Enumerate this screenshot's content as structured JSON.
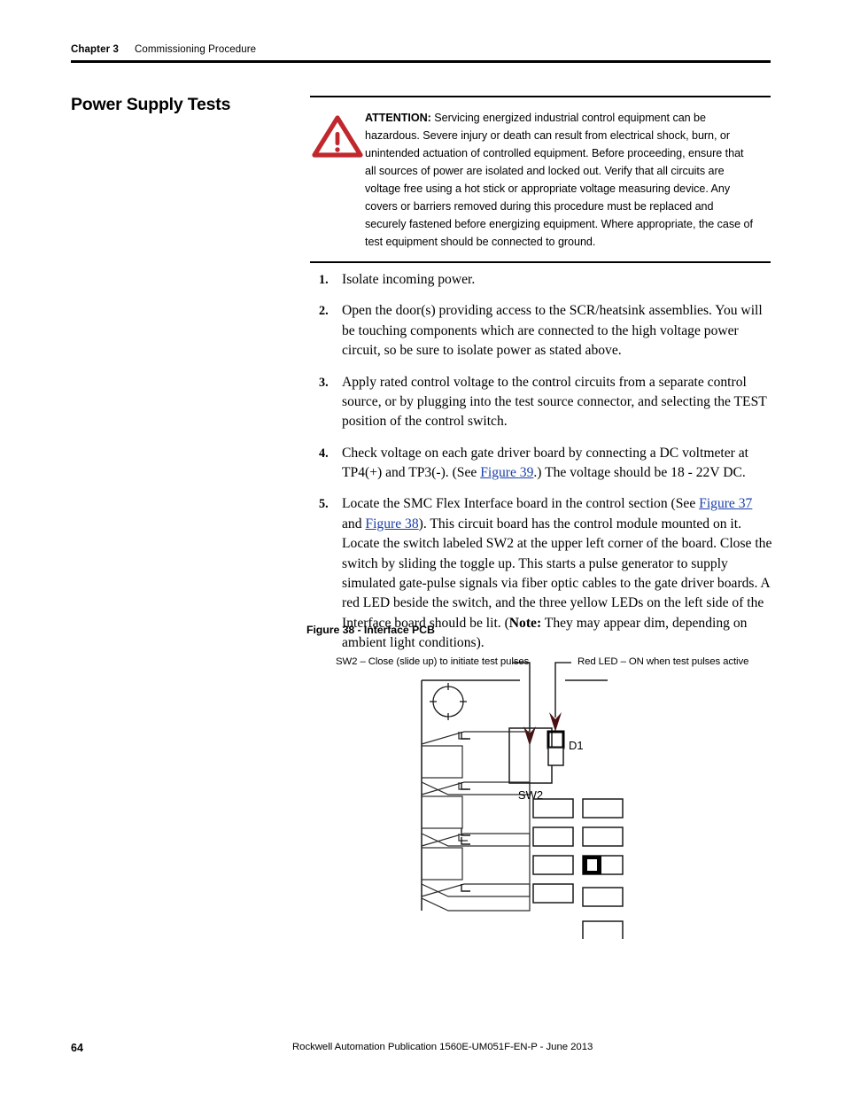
{
  "header": {
    "chapter": "Chapter 3",
    "topic": "Commissioning Procedure"
  },
  "section": {
    "title": "Power Supply Tests"
  },
  "attention": {
    "icon": "warning-triangle-icon",
    "label": "ATTENTION:",
    "body": " Servicing energized industrial control equipment can be hazardous. Severe injury or death can result from electrical shock, burn, or unintended actuation of controlled equipment. Before proceeding, ensure that all sources of power are isolated and locked out. Verify that all circuits are voltage free using a hot stick or appropriate voltage measuring device. Any covers or barriers removed during this procedure must be replaced and securely fastened before energizing equipment. Where appropriate, the case of test equipment should be connected to ground.",
    "accent_color": "#c0282d"
  },
  "steps": [
    {
      "num": "1.",
      "text": "Isolate incoming power."
    },
    {
      "num": "2.",
      "text": "Open the door(s) providing access to the SCR/heatsink assemblies. You will be touching components which are connected to the high voltage power circuit, so be sure to isolate power as stated above."
    },
    {
      "num": "3.",
      "text": "Apply rated control voltage to the control circuits from a separate control source, or by plugging into the test source connector, and selecting the TEST position of the control switch."
    },
    {
      "num": "4.",
      "part_a": "Check voltage on each gate driver board by connecting a DC voltmeter at TP4(+) and TP3(-). (See ",
      "link_1": "Figure 39",
      "part_b": ".) The voltage should be 18 - 22V DC."
    },
    {
      "num": "5.",
      "part_a": "Locate the SMC Flex Interface board in the control section (See ",
      "link_1": "Figure 37",
      "part_b": " and ",
      "link_2": "Figure 38",
      "part_c": "). This circuit board has the control module mounted on it. Locate the switch labeled SW2 at the upper left corner of the board. Close the switch by sliding the toggle up. This starts a pulse generator to supply simulated gate-pulse signals via fiber optic cables to the gate driver boards. A red LED beside the switch, and the three yellow LEDs on the left side of the Interface board should be lit. (",
      "note_label": "Note:",
      "part_d": " They may appear dim, depending on ambient light conditions)."
    }
  ],
  "figure": {
    "caption": "Figure 38 - Interface PCB",
    "callout_left": "SW2 – Close (slide up) to initiate test pulses",
    "callout_right": "Red LED – ON when test pulses active",
    "switch_label": "SW2",
    "led_label": "D1",
    "arrow_color": "#4a1010"
  },
  "footer": {
    "page_number": "64",
    "publication": "Rockwell Automation Publication 1560E-UM051F-EN-P - June 2013"
  },
  "links": {
    "color": "#1b3faa"
  }
}
